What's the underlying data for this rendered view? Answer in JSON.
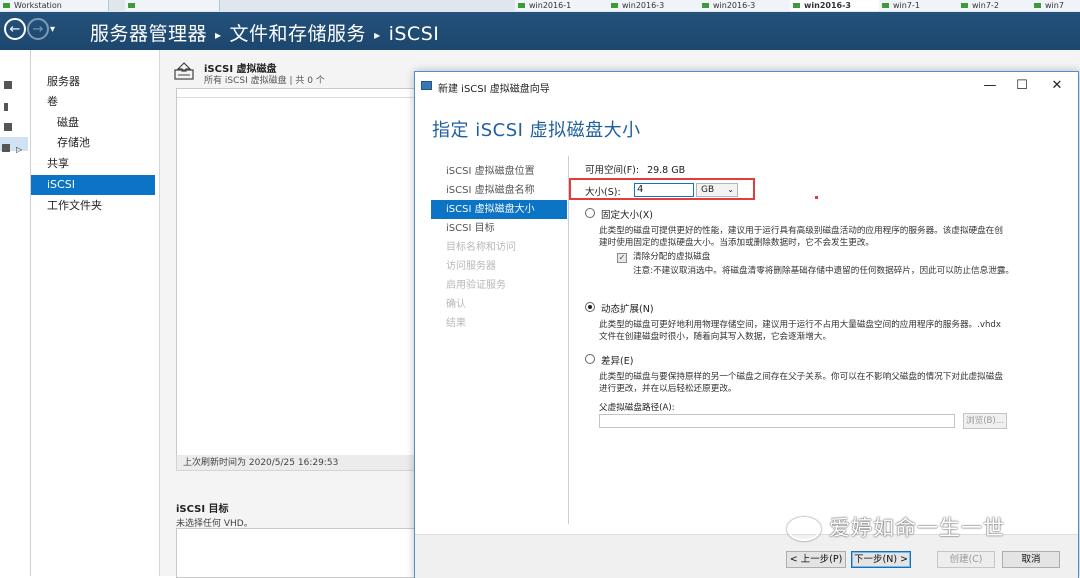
{
  "taskbar": {
    "tabs": [
      "Workstation",
      "win2016-1",
      "win2016-3",
      "win2016-3",
      "win7-1",
      "win7-2",
      "win7"
    ]
  },
  "header": {
    "crumbs": [
      "服务器管理器",
      "文件和存储服务",
      "iSCSI"
    ],
    "back_glyph": "←",
    "forward_glyph": "→",
    "dropdown_glyph": "▾",
    "separator": "▸"
  },
  "sidebar": {
    "items": [
      {
        "label": "服务器"
      },
      {
        "label": "卷"
      },
      {
        "label": "磁盘"
      },
      {
        "label": "存储池"
      },
      {
        "label": "共享"
      },
      {
        "label": "iSCSI"
      },
      {
        "label": "工作文件夹"
      }
    ]
  },
  "main": {
    "vdisk_title": "iSCSI 虚拟磁盘",
    "vdisk_subtitle": "所有 iSCSI 虚拟磁盘 | 共 0 个",
    "refresh_text": "上次刷新时间为 2020/5/25 16:29:53",
    "target_title": "iSCSI 目标",
    "target_subtitle": "未选择任何 VHD。"
  },
  "wizard": {
    "window_title": "新建 iSCSI 虚拟磁盘向导",
    "minimize": "—",
    "maximize": "☐",
    "close": "✕",
    "heading": "指定 iSCSI 虚拟磁盘大小",
    "steps": [
      {
        "label": "iSCSI 虚拟磁盘位置",
        "state": "normal"
      },
      {
        "label": "iSCSI 虚拟磁盘名称",
        "state": "normal"
      },
      {
        "label": "iSCSI 虚拟磁盘大小",
        "state": "current"
      },
      {
        "label": "iSCSI 目标",
        "state": "normal"
      },
      {
        "label": "目标名称和访问",
        "state": "disabled"
      },
      {
        "label": "访问服务器",
        "state": "disabled"
      },
      {
        "label": "启用验证服务",
        "state": "disabled"
      },
      {
        "label": "确认",
        "state": "disabled"
      },
      {
        "label": "结果",
        "state": "disabled"
      }
    ],
    "available_label": "可用空间(F):",
    "available_value": "29.8 GB",
    "size_label": "大小(S):",
    "size_value": "4",
    "size_unit": "GB",
    "fixed": {
      "label": "固定大小(X)",
      "desc": "此类型的磁盘可提供更好的性能，建议用于运行具有高级别磁盘活动的应用程序的服务器。该虚拟硬盘在创建时使用固定的虚拟硬盘大小。当添加或删除数据时，它不会发生更改。",
      "clear_label": "清除分配的虚拟磁盘",
      "clear_desc": "注意:不建议取消选中。将磁盘清零将删除基础存储中遗留的任何数据碎片，因此可以防止信息泄露。"
    },
    "dynamic": {
      "label": "动态扩展(N)",
      "desc": "此类型的磁盘可更好地利用物理存储空间，建议用于运行不占用大量磁盘空间的应用程序的服务器。.vhdx 文件在创建磁盘时很小，随着向其写入数据，它会逐渐增大。"
    },
    "differencing": {
      "label": "差异(E)",
      "desc": "此类型的磁盘与要保持原样的另一个磁盘之间存在父子关系。你可以在不影响父磁盘的情况下对此虚拟磁盘进行更改，并在以后轻松还原更改。",
      "parent_label": "父虚拟磁盘路径(A):",
      "parent_value": "",
      "browse_label": "浏览(B)..."
    },
    "selected_option": "dynamic",
    "buttons": {
      "prev": "< 上一步(P)",
      "next": "下一步(N) >",
      "create": "创建(C)",
      "cancel": "取消"
    }
  },
  "watermark": "爱婷如命一生一世",
  "colors": {
    "header_bg": "#1f4e79",
    "selection_blue": "#0b74c4",
    "heading_blue": "#1f5f9e",
    "highlight_red": "#e23c3c"
  }
}
